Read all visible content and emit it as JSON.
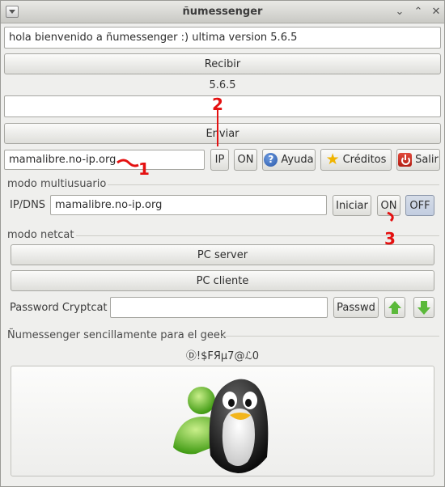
{
  "window": {
    "title": "ñumessenger"
  },
  "top": {
    "message_text": "hola bienvenido a ñumessenger :) ultima version 5.6.5",
    "receive_label": "Recibir",
    "version_label": "5.6.5",
    "send_input": "",
    "send_label": "Enviar"
  },
  "server_row": {
    "host_value": "mamalibre.no-ip.org",
    "ip_label": "IP",
    "on_label": "ON",
    "help_label": "Ayuda",
    "credits_label": "Créditos",
    "exit_label": "Salir"
  },
  "multiuser": {
    "title": "modo multiusuario",
    "ipdns_label": "IP/DNS",
    "ipdns_value": "mamalibre.no-ip.org",
    "start_label": "Iniciar",
    "on_label": "ON",
    "off_label": "OFF"
  },
  "netcat": {
    "title": "modo netcat",
    "server_label": "PC server",
    "client_label": "PC cliente",
    "password_label": "Password Cryptcat",
    "password_value": "",
    "passwd_button": "Passwd"
  },
  "footer": {
    "title": "Ñumessenger sencillamente para el geek",
    "signature": "Ⓓ!$FЯµ7@ℒ0"
  },
  "annotations": {
    "a1": "1",
    "a2": "2",
    "a3": "3"
  },
  "colors": {
    "annotation": "#e41010",
    "arrow_green": "#5bb93a",
    "window_bg": "#efefed"
  }
}
